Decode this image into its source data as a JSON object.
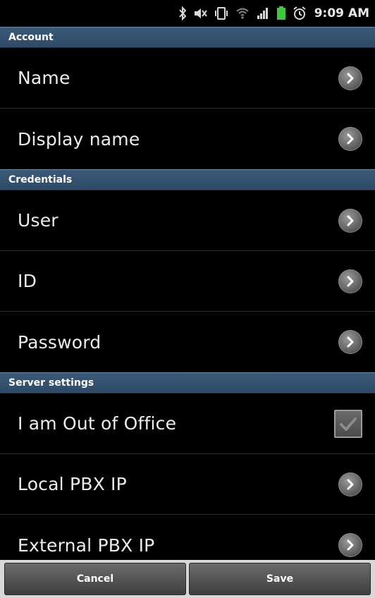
{
  "status_bar": {
    "time": "9:09 AM",
    "icons": [
      "bluetooth-icon",
      "mute-icon",
      "vibrate-icon",
      "wifi-icon",
      "signal-icon",
      "battery-icon",
      "alarm-icon"
    ]
  },
  "sections": {
    "account": {
      "title": "Account",
      "items": [
        {
          "label": "Name"
        },
        {
          "label": "Display name"
        }
      ]
    },
    "credentials": {
      "title": "Credentials",
      "items": [
        {
          "label": "User"
        },
        {
          "label": "ID"
        },
        {
          "label": "Password"
        }
      ]
    },
    "server": {
      "title": "Server settings",
      "items": [
        {
          "label": "I am Out of Office",
          "checked": true
        },
        {
          "label": "Local PBX IP"
        },
        {
          "label": "External PBX IP"
        }
      ]
    }
  },
  "buttons": {
    "cancel": "Cancel",
    "save": "Save"
  },
  "colors": {
    "section_header": "#34506e",
    "background": "#000000",
    "battery": "#3fc83f"
  }
}
